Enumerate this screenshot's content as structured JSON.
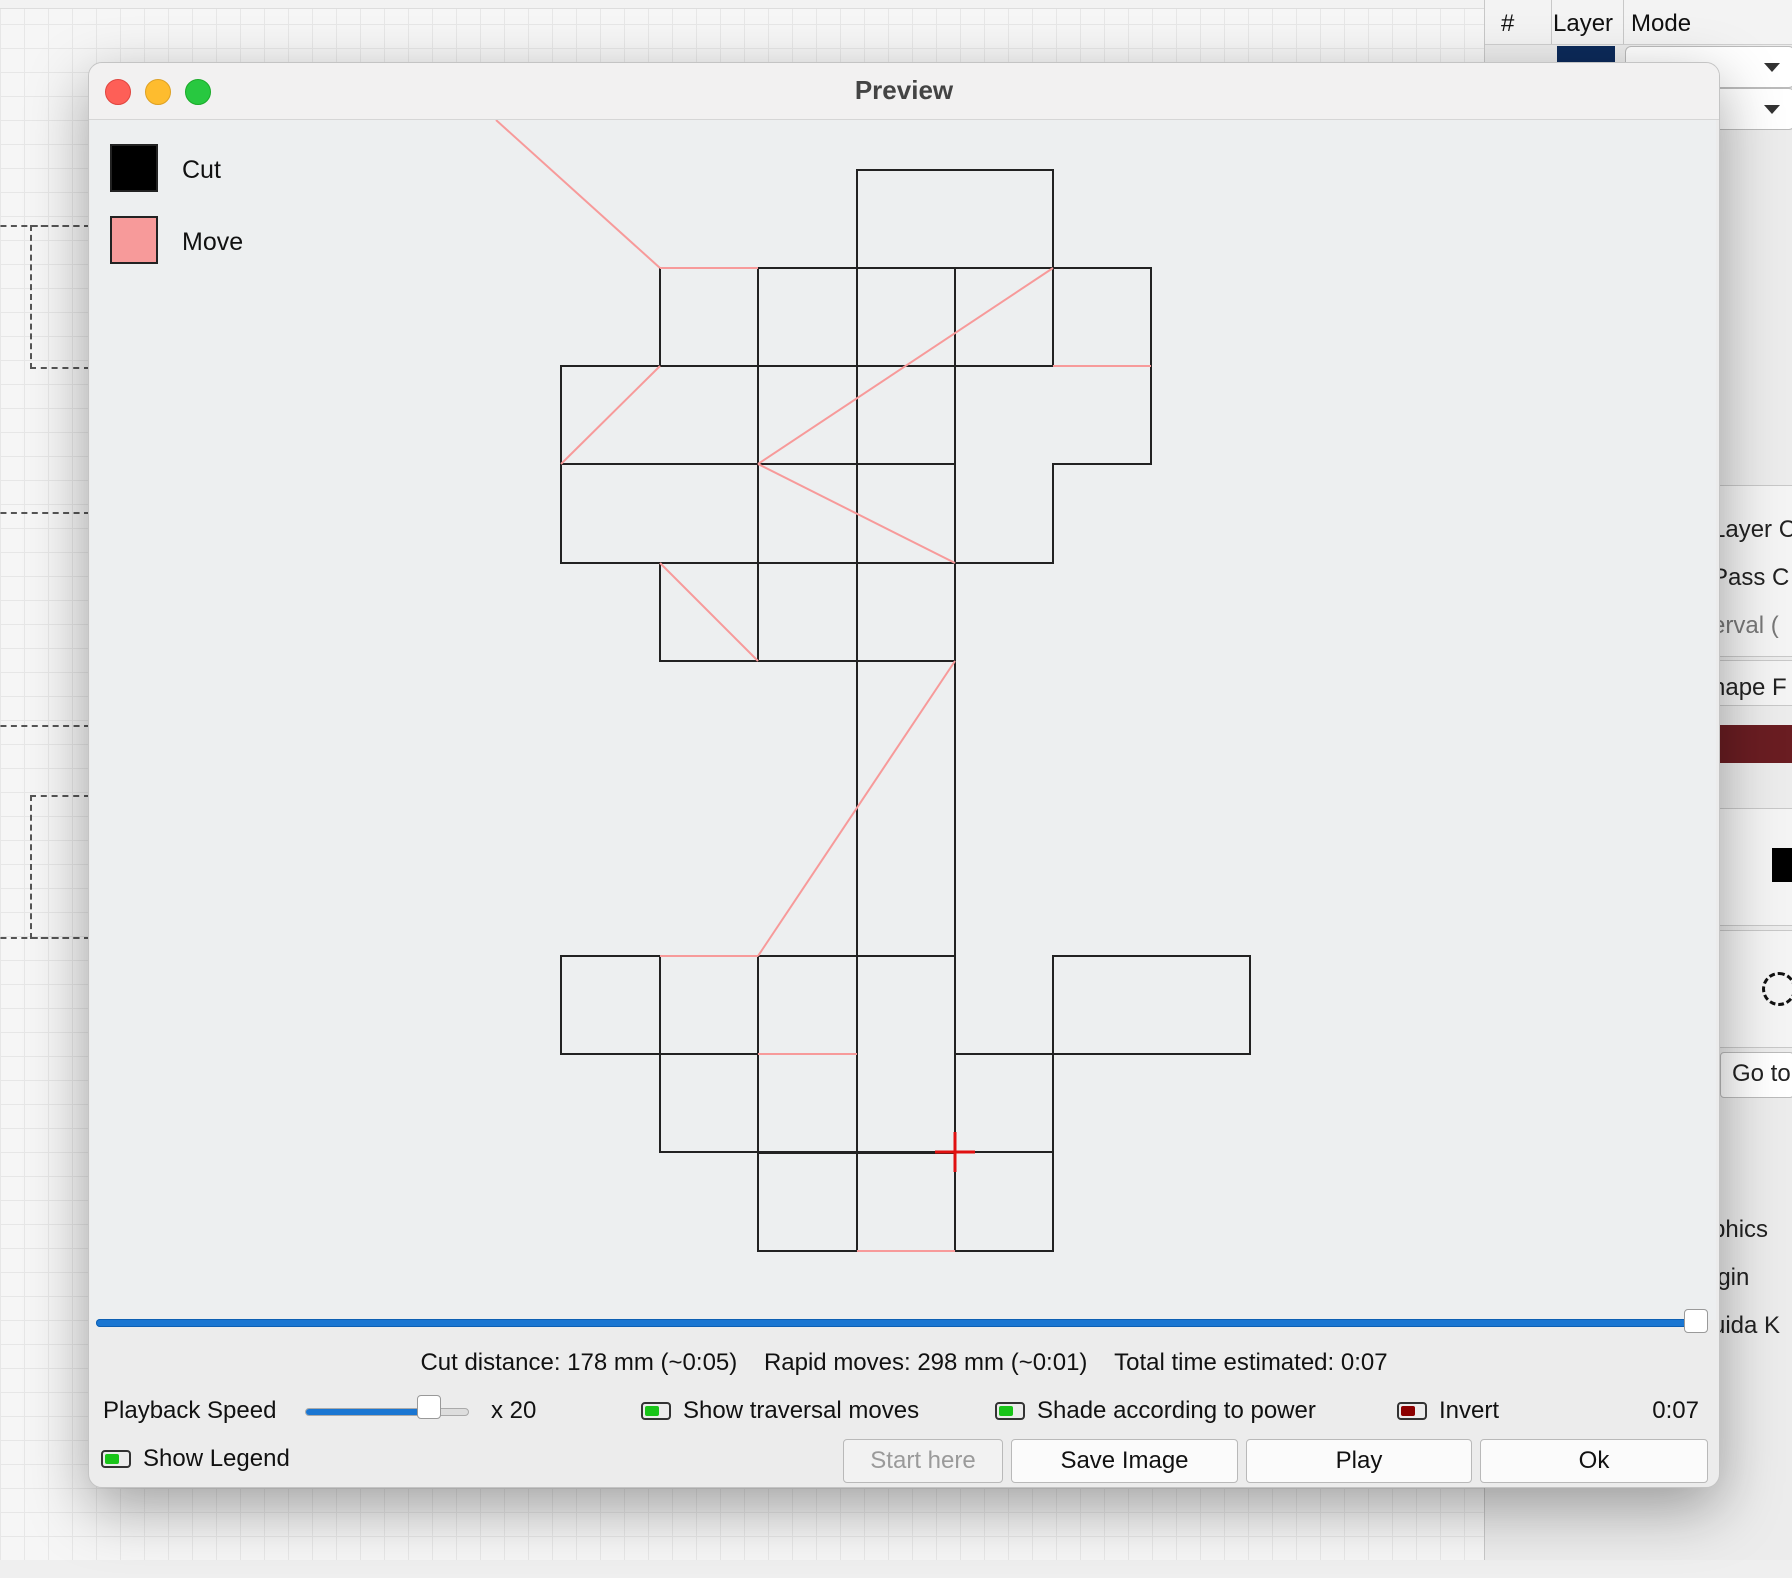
{
  "window": {
    "title": "Preview"
  },
  "legend": {
    "cut_label": "Cut",
    "move_label": "Move",
    "cut_color": "#000000",
    "move_color": "#f79a9a"
  },
  "stats": {
    "cut": "Cut distance: 178 mm (~0:05)",
    "rapid": "Rapid moves: 298 mm (~0:01)",
    "total": "Total time estimated: 0:07"
  },
  "controls": {
    "speed_label": "Playback Speed",
    "speed_multiplier": "x 20",
    "speed_fraction": 0.8,
    "playback_progress": 1.0,
    "show_traversal": {
      "label": "Show traversal moves",
      "checked": true
    },
    "shade_power": {
      "label": "Shade according to power",
      "checked": true
    },
    "invert": {
      "label": "Invert",
      "checked": false
    },
    "time": "0:07",
    "show_legend": {
      "label": "Show Legend",
      "checked": true
    }
  },
  "buttons": {
    "start_here": "Start here",
    "save_image": "Save Image",
    "play": "Play",
    "ok": "Ok"
  },
  "background": {
    "layer_panel_headers": [
      "#",
      "Layer",
      "Mode"
    ],
    "side_labels": [
      "Layer C",
      "Pass C",
      "erval (",
      "hape F",
      "Go to",
      "phics",
      "igin",
      "uida K"
    ]
  },
  "colors": {
    "accent": "#1a76d2",
    "toggle_on": "#19c419",
    "toggle_off": "#8c0000",
    "cursor": "#e01010"
  }
}
